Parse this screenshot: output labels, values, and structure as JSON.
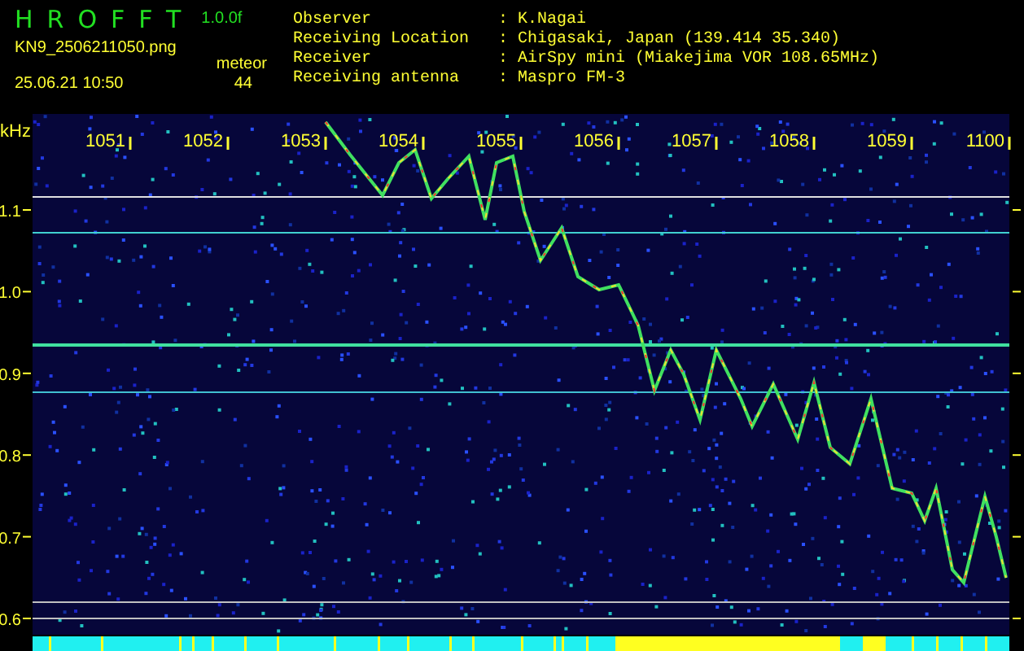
{
  "header": {
    "app_title": "HROFFT",
    "version": "1.0.0f",
    "filename": "KN9_2506211050.png",
    "datetime": "25.06.21 10:50",
    "count_label": "meteor",
    "count": "44"
  },
  "info": [
    {
      "label": "Observer",
      "separator": ":",
      "value": "K.Nagai"
    },
    {
      "label": "Receiving Location",
      "separator": ":",
      "value": "Chigasaki, Japan (139.414 35.340)"
    },
    {
      "label": "Receiver",
      "separator": ":",
      "value": "AirSpy mini (Miakejima VOR 108.65MHz)"
    },
    {
      "label": "Receiving antenna",
      "separator": ":",
      "value": "Maspro FM-3"
    }
  ],
  "spectrogram": {
    "y_unit": "kHz",
    "y_ticks": [
      "1.1",
      "1.0",
      "0.9",
      "0.8",
      "0.7",
      "0.6"
    ],
    "x_ticks": [
      "1051",
      "1052",
      "1053",
      "1054",
      "1055",
      "1056",
      "1057",
      "1058",
      "1059",
      "1100"
    ]
  }
}
